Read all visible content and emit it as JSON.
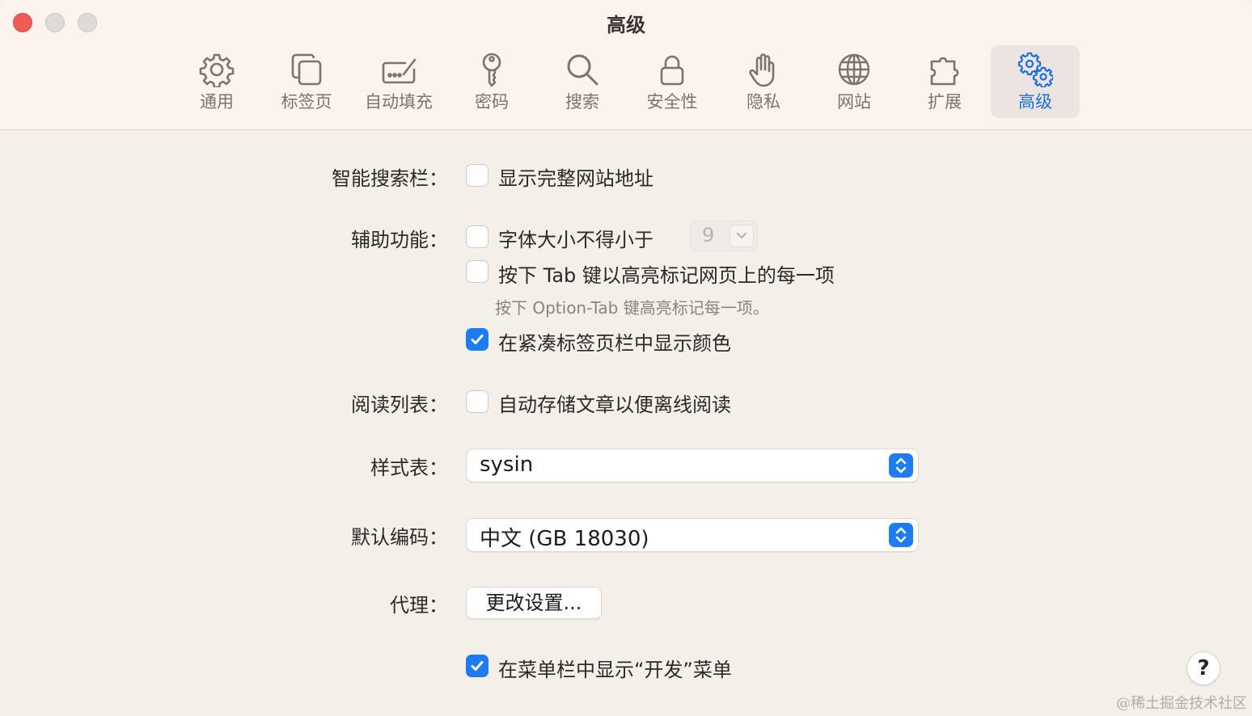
{
  "window": {
    "title": "高级"
  },
  "toolbar": {
    "items": [
      {
        "label": "通用",
        "icon": "gear-icon"
      },
      {
        "label": "标签页",
        "icon": "tabs-icon"
      },
      {
        "label": "自动填充",
        "icon": "autofill-icon"
      },
      {
        "label": "密码",
        "icon": "key-icon"
      },
      {
        "label": "搜索",
        "icon": "magnifier-icon"
      },
      {
        "label": "安全性",
        "icon": "lock-icon"
      },
      {
        "label": "隐私",
        "icon": "hand-icon"
      },
      {
        "label": "网站",
        "icon": "globe-icon"
      },
      {
        "label": "扩展",
        "icon": "puzzle-icon"
      },
      {
        "label": "高级",
        "icon": "gears-icon",
        "selected": true
      }
    ]
  },
  "smart_search": {
    "label": "智能搜索栏：",
    "option": "显示完整网站地址",
    "checked": false
  },
  "accessibility": {
    "label": "辅助功能：",
    "min_font": {
      "option": "字体大小不得小于",
      "checked": false,
      "value": "9"
    },
    "tab_highlight": {
      "option": "按下 Tab 键以高亮标记网页上的每一项",
      "checked": false,
      "note": "按下 Option-Tab 键高亮标记每一项。"
    },
    "compact_colors": {
      "option": "在紧凑标签页栏中显示颜色",
      "checked": true
    }
  },
  "reading_list": {
    "label": "阅读列表：",
    "option": "自动存储文章以便离线阅读",
    "checked": false
  },
  "stylesheet": {
    "label": "样式表：",
    "value": "sysin"
  },
  "encoding": {
    "label": "默认编码：",
    "value": "中文 (GB 18030)"
  },
  "proxy": {
    "label": "代理：",
    "button": "更改设置..."
  },
  "develop_menu": {
    "option": "在菜单栏中显示“开发”菜单",
    "checked": true
  },
  "help": {
    "label": "?"
  },
  "watermark": {
    "text": "@稀土掘金技术社区"
  },
  "colors": {
    "accent": "#1f7cf0",
    "background": "#f5efea",
    "titlebar": "#fcf2ee"
  }
}
